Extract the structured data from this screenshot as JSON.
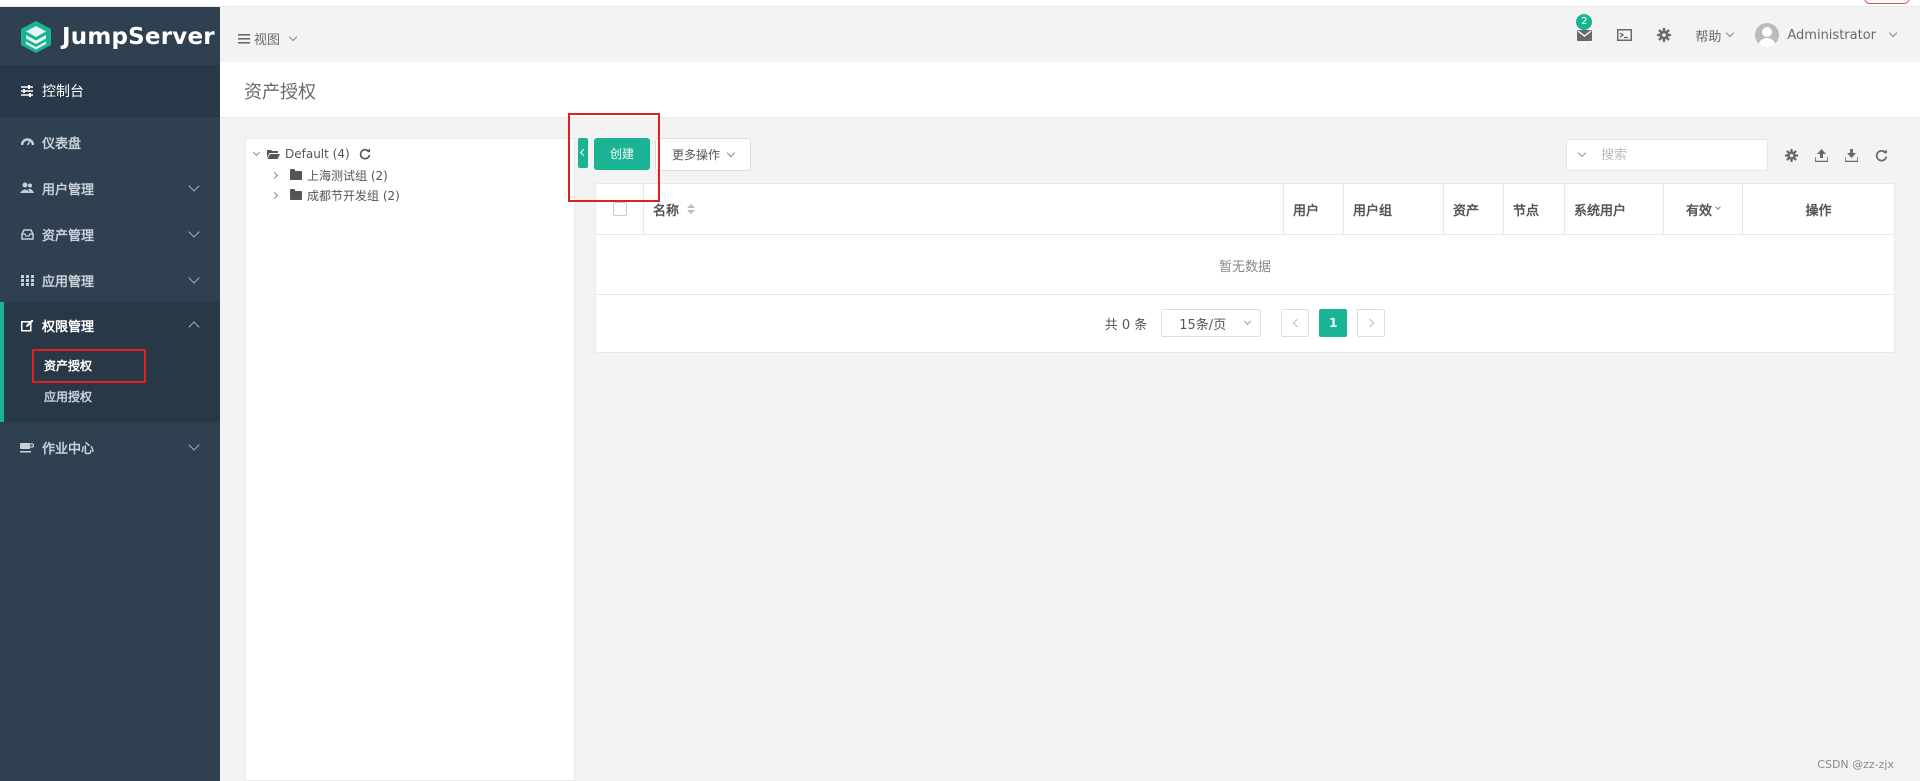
{
  "app": {
    "brand": "JumpServer"
  },
  "sidebar": {
    "console_label": "控制台",
    "items": [
      {
        "label": "仪表盘",
        "icon": "dashboard-icon"
      },
      {
        "label": "用户管理",
        "icon": "users-icon"
      },
      {
        "label": "资产管理",
        "icon": "inbox-icon"
      },
      {
        "label": "应用管理",
        "icon": "grid-icon"
      },
      {
        "label": "权限管理",
        "icon": "edit-icon",
        "expanded": true,
        "children": [
          {
            "label": "资产授权",
            "active": true
          },
          {
            "label": "应用授权"
          }
        ]
      },
      {
        "label": "作业中心",
        "icon": "coffee-icon"
      }
    ]
  },
  "header": {
    "view_label": "视图",
    "mail_badge": "2",
    "help_label": "帮助",
    "user_label": "Administrator"
  },
  "page": {
    "title": "资产授权"
  },
  "tree": {
    "root": {
      "label": "Default (4)"
    },
    "children": [
      {
        "label": "上海测试组 (2)"
      },
      {
        "label": "成都节开发组 (2)"
      }
    ]
  },
  "toolbar": {
    "create_label": "创建",
    "more_label": "更多操作",
    "search_placeholder": "搜索"
  },
  "table": {
    "columns": [
      "名称",
      "用户",
      "用户组",
      "资产",
      "节点",
      "系统用户",
      "有效",
      "操作"
    ],
    "empty_text": "暂无数据"
  },
  "pagination": {
    "total": "共 0 条",
    "page_size": "15条/页",
    "current_page": "1"
  },
  "watermark": "CSDN @zz-zjx",
  "colors": {
    "sidebar_bg": "#2f4050",
    "accent": "#1ab394",
    "highlight_box": "#e02020"
  }
}
